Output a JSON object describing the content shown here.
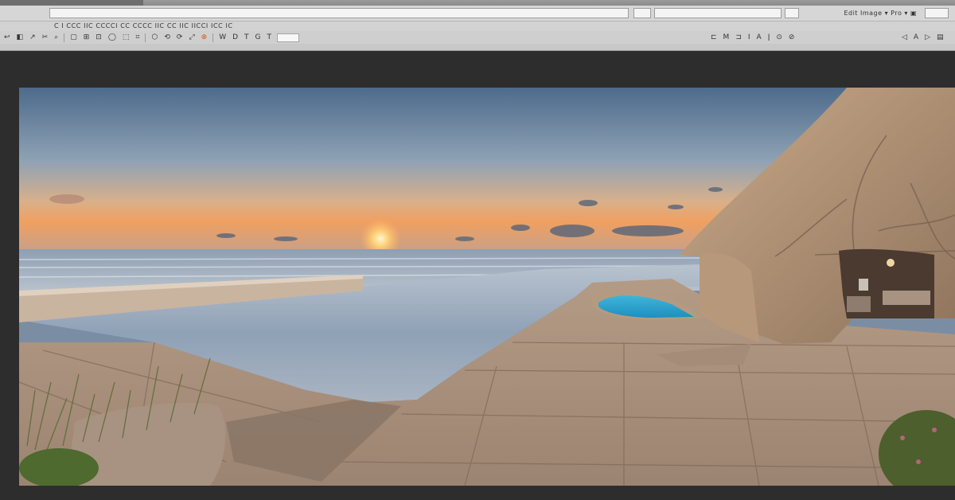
{
  "app": {
    "menu_right_text": "Edit Image ▾ Pro ▾ ▣"
  },
  "toolbar": {
    "row1_text": "C    I   CCC   IIC   CCCCI   CC   CCCC IIC   CC   IIC  IICCI  ICC   IC",
    "row2_left": [
      "↩",
      "◧",
      "↗",
      "✂",
      "⌕",
      "▢",
      "⊞",
      "⊡",
      "◯",
      "⬚",
      "⌗",
      "⬡",
      "⟲",
      "⟳",
      "⤢",
      "⊕"
    ],
    "row2_mid": [
      "W",
      "D",
      "T",
      "G",
      "T"
    ],
    "row2_right": [
      "⊏",
      "M",
      "⊐",
      "I",
      "A",
      "ǀ",
      "⊙",
      "⊘"
    ],
    "row2_far_right": [
      "◁",
      "A",
      "▷",
      "▤"
    ]
  },
  "canvas": {
    "image_alt": "Seaside pool terrace at sunset with stone cave house"
  }
}
